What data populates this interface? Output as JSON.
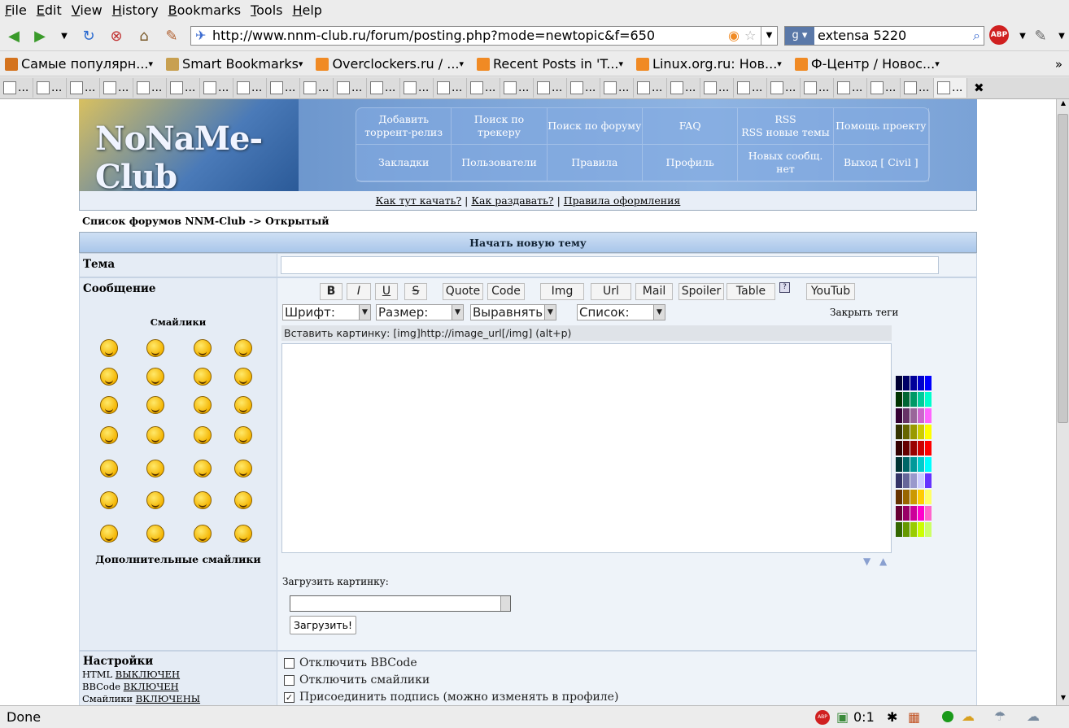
{
  "menu": [
    "File",
    "Edit",
    "View",
    "History",
    "Bookmarks",
    "Tools",
    "Help"
  ],
  "url": "http://www.nnm-club.ru/forum/posting.php?mode=newtopic&f=650",
  "search_value": "extensa 5220",
  "bookmarks": [
    {
      "label": "Самые популярн...",
      "icon": "folder-icon",
      "color": "#d4731e"
    },
    {
      "label": "Smart Bookmarks",
      "icon": "folder-icon",
      "color": "#c8a050"
    },
    {
      "label": "Overclockers.ru / ...",
      "icon": "rss-icon",
      "color": "#f08a24"
    },
    {
      "label": "Recent Posts in 'T...",
      "icon": "rss-icon",
      "color": "#f08a24"
    },
    {
      "label": "Linux.org.ru: Нов...",
      "icon": "rss-icon",
      "color": "#f08a24"
    },
    {
      "label": "Ф-Центр / Новос...",
      "icon": "rss-icon",
      "color": "#f08a24"
    }
  ],
  "tab_label": "...",
  "tab_count": 29,
  "site": {
    "nav_top": [
      "Добавить\nторрент-релиз",
      "Поиск по трекеру",
      "Поиск по форуму",
      "FAQ",
      "RSS\nRSS новые темы",
      "Помощь проекту"
    ],
    "nav_bottom": [
      "Закладки",
      "Пользователи",
      "Правила",
      "Профиль",
      "Новых сообщ. нет",
      "Выход [ Civil ]"
    ],
    "help_links": [
      "Как тут качать?",
      "Как раздавать?",
      "Правила оформления"
    ],
    "help_sep": "|",
    "breadcrumb": "Список форумов NNM-Club -> Открытый",
    "form_title": "Начать новую тему",
    "subject_label": "Тема",
    "message_label": "Сообщение",
    "smilies_title": "Смайлики",
    "more_smilies": "Дополнительные смайлики",
    "bbcode_buttons": [
      "B",
      "I",
      "U",
      "S",
      "Quote",
      "Code",
      "Img",
      "Url",
      "Mail",
      "Spoiler",
      "Table",
      "YouTub"
    ],
    "help_icon": "?",
    "selects": [
      "Шрифт:",
      "Размер:",
      "Выравнять",
      "Список:"
    ],
    "close_tags": "Закрыть теги",
    "hint": "Вставить картинку: [img]http://image_url[/img]  (alt+p)",
    "upload_label": "Загрузить картинку:",
    "upload_button": "Загрузить!",
    "settings_title": "Настройки",
    "settings_items": [
      {
        "pre": "HTML",
        "link": "ВЫКЛЮЧЕН"
      },
      {
        "pre": "BBCode",
        "link": "ВКЛЮЧЕН"
      },
      {
        "pre": "Смайлики",
        "link": "ВКЛЮЧЕНЫ"
      }
    ],
    "options": [
      {
        "label": "Отключить BBCode",
        "checked": false
      },
      {
        "label": "Отключить смайлики",
        "checked": false
      },
      {
        "label": "Присоединить подпись (можно изменять в профиле)",
        "checked": true
      }
    ]
  },
  "status": {
    "text": "Done",
    "counter": "0:1"
  }
}
